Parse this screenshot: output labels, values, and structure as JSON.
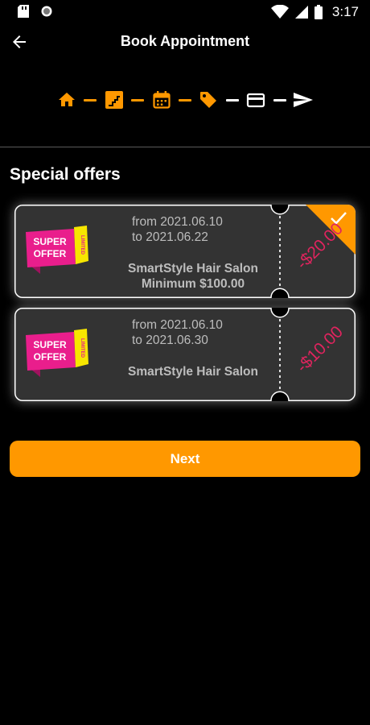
{
  "status_bar": {
    "time": "3:17"
  },
  "header": {
    "title": "Book Appointment"
  },
  "steps": [
    {
      "icon": "home-icon",
      "state": "done"
    },
    {
      "icon": "stairs-icon",
      "state": "done"
    },
    {
      "icon": "calendar-icon",
      "state": "done"
    },
    {
      "icon": "tag-icon",
      "state": "active"
    },
    {
      "icon": "credit-card-icon",
      "state": "pending"
    },
    {
      "icon": "send-icon",
      "state": "pending"
    }
  ],
  "section_title": "Special offers",
  "offers": [
    {
      "badge": {
        "line1": "SUPER",
        "line2": "OFFER",
        "ribbon": "LIMITED"
      },
      "from": "from 2021.06.10",
      "to": "to 2021.06.22",
      "salon": "SmartStyle Hair Salon",
      "minimum": "Minimum $100.00",
      "discount": "-$20.00",
      "selected": true
    },
    {
      "badge": {
        "line1": "SUPER",
        "line2": "OFFER",
        "ribbon": "LIMITED"
      },
      "from": "from 2021.06.10",
      "to": "to 2021.06.30",
      "salon": "SmartStyle Hair Salon",
      "minimum": "",
      "discount": "-$10.00",
      "selected": false
    }
  ],
  "next_label": "Next",
  "colors": {
    "accent": "#ff9800",
    "discount": "#e0245e",
    "card_bg": "#333333",
    "badge_pink": "#e91e8c",
    "badge_yellow": "#f7e600"
  }
}
